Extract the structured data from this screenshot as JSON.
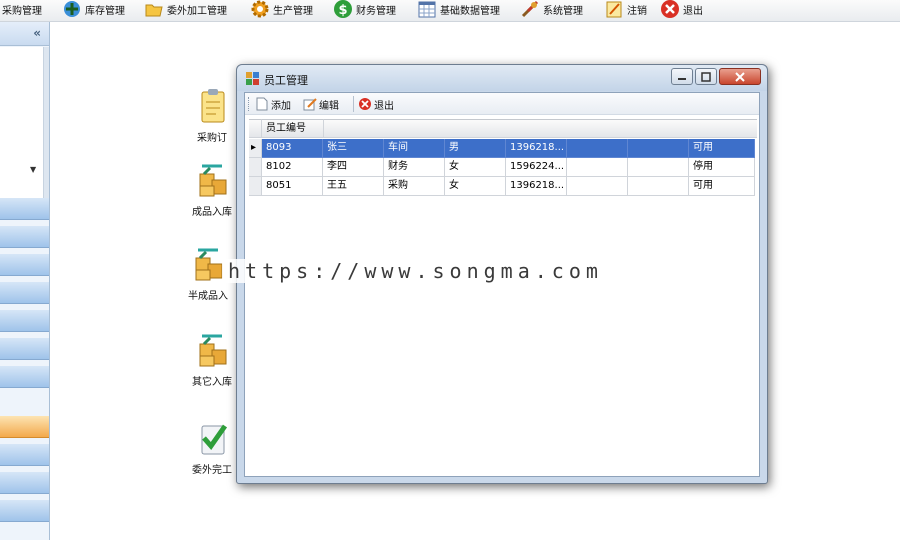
{
  "menubar": {
    "items": [
      {
        "label": "采购管理",
        "icon": "purchase-icon"
      },
      {
        "label": "库存管理",
        "icon": "inventory-icon"
      },
      {
        "label": "委外加工管理",
        "icon": "folder-icon"
      },
      {
        "label": "生产管理",
        "icon": "gear-icon"
      },
      {
        "label": "财务管理",
        "icon": "dollar-icon"
      },
      {
        "label": "基础数据管理",
        "icon": "calendar-grid-icon"
      },
      {
        "label": "系统管理",
        "icon": "tools-icon"
      },
      {
        "label": "注销",
        "icon": "logout-pencil-icon"
      },
      {
        "label": "退出",
        "icon": "exit-icon"
      }
    ]
  },
  "sidebar": {
    "collapse_glyph": "«"
  },
  "desktop": {
    "items": [
      {
        "label": "采购订",
        "icon": "clipboard-icon"
      },
      {
        "label": "成品入库",
        "icon": "boxes-in-icon"
      },
      {
        "label": "半成品入",
        "icon": "boxes-in-icon"
      },
      {
        "label": "其它入库",
        "icon": "boxes-in-icon"
      },
      {
        "label": "委外完工",
        "icon": "check-clipboard-icon"
      }
    ]
  },
  "window": {
    "title": "员工管理",
    "toolbar": {
      "add": "添加",
      "edit": "编辑",
      "exit": "退出"
    },
    "grid": {
      "header": "员工编号",
      "rows": [
        {
          "id": "8093",
          "name": "张三",
          "dept": "车间",
          "gender": "男",
          "phone": "1396218...",
          "status": "可用",
          "selected": true
        },
        {
          "id": "8102",
          "name": "李四",
          "dept": "财务",
          "gender": "女",
          "phone": "1596224...",
          "status": "停用",
          "selected": false
        },
        {
          "id": "8051",
          "name": "王五",
          "dept": "采购",
          "gender": "女",
          "phone": "1396218...",
          "status": "可用",
          "selected": false
        }
      ]
    }
  },
  "watermark": "https://www.songma.com",
  "colors": {
    "selection": "#3d6fc9",
    "window_frame": "#c9d8ea",
    "sidebar_active": "#f3a94c"
  }
}
